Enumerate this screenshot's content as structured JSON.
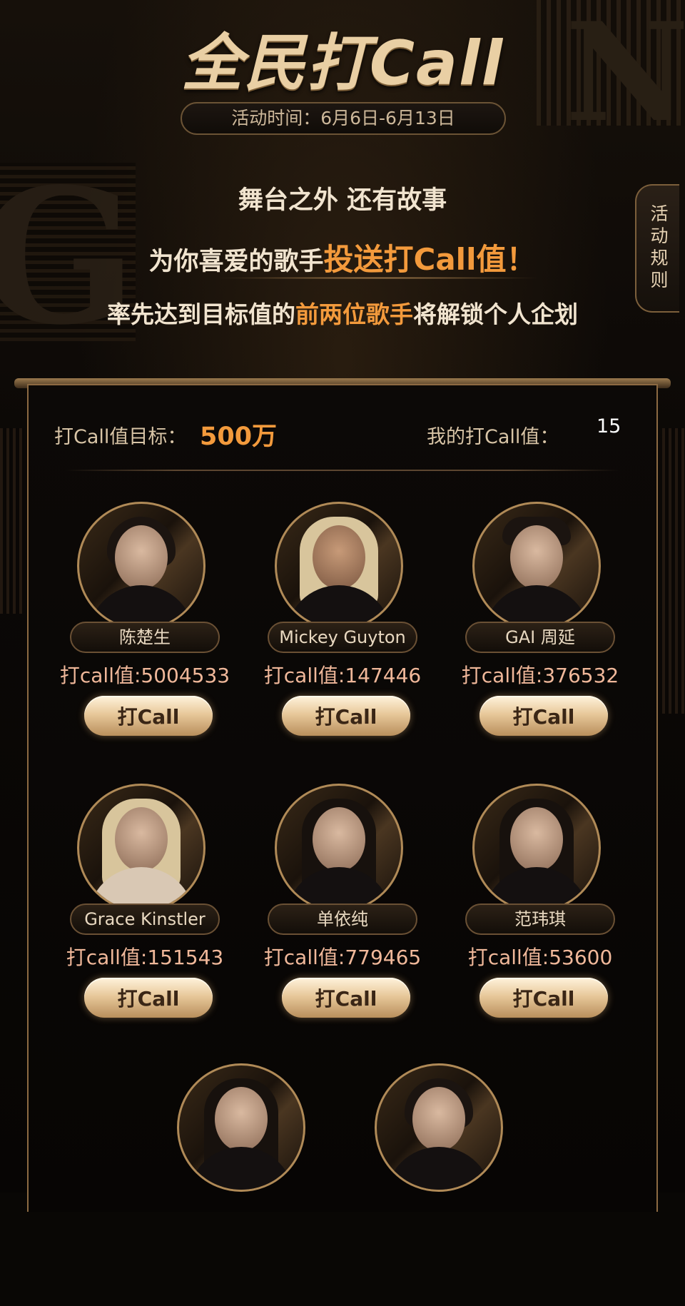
{
  "header": {
    "title": "全民打Call",
    "date": "活动时间：6月6日-6月13日",
    "tagline1": "舞台之外 还有故事",
    "tagline2_pre": "为你喜爱的歌手",
    "tagline2_hl": "投送打Call值！",
    "tagline3_pre": "率先达到目标值的",
    "tagline3_hl": "前两位歌手",
    "tagline3_post": "将解锁个人企划",
    "rules_label": "活动规则"
  },
  "stats": {
    "goal_label": "打Call值目标：",
    "goal_value": "500万",
    "mine_label": "我的打Call值：",
    "mine_value": "15"
  },
  "singers": [
    {
      "name": "陈楚生",
      "score": "打call值:5004533",
      "button": "打Call"
    },
    {
      "name": "Mickey Guyton",
      "score": "打call值:147446",
      "button": "打Call"
    },
    {
      "name": "GAI 周延",
      "score": "打call值:376532",
      "button": "打Call"
    },
    {
      "name": "Grace Kinstler",
      "score": "打call值:151543",
      "button": "打Call"
    },
    {
      "name": "单依纯",
      "score": "打call值:779465",
      "button": "打Call"
    },
    {
      "name": "范玮琪",
      "score": "打call值:53600",
      "button": "打Call"
    }
  ],
  "colors": {
    "accent": "#f39a3c",
    "gold": "#b08a57",
    "background": "#090705"
  }
}
